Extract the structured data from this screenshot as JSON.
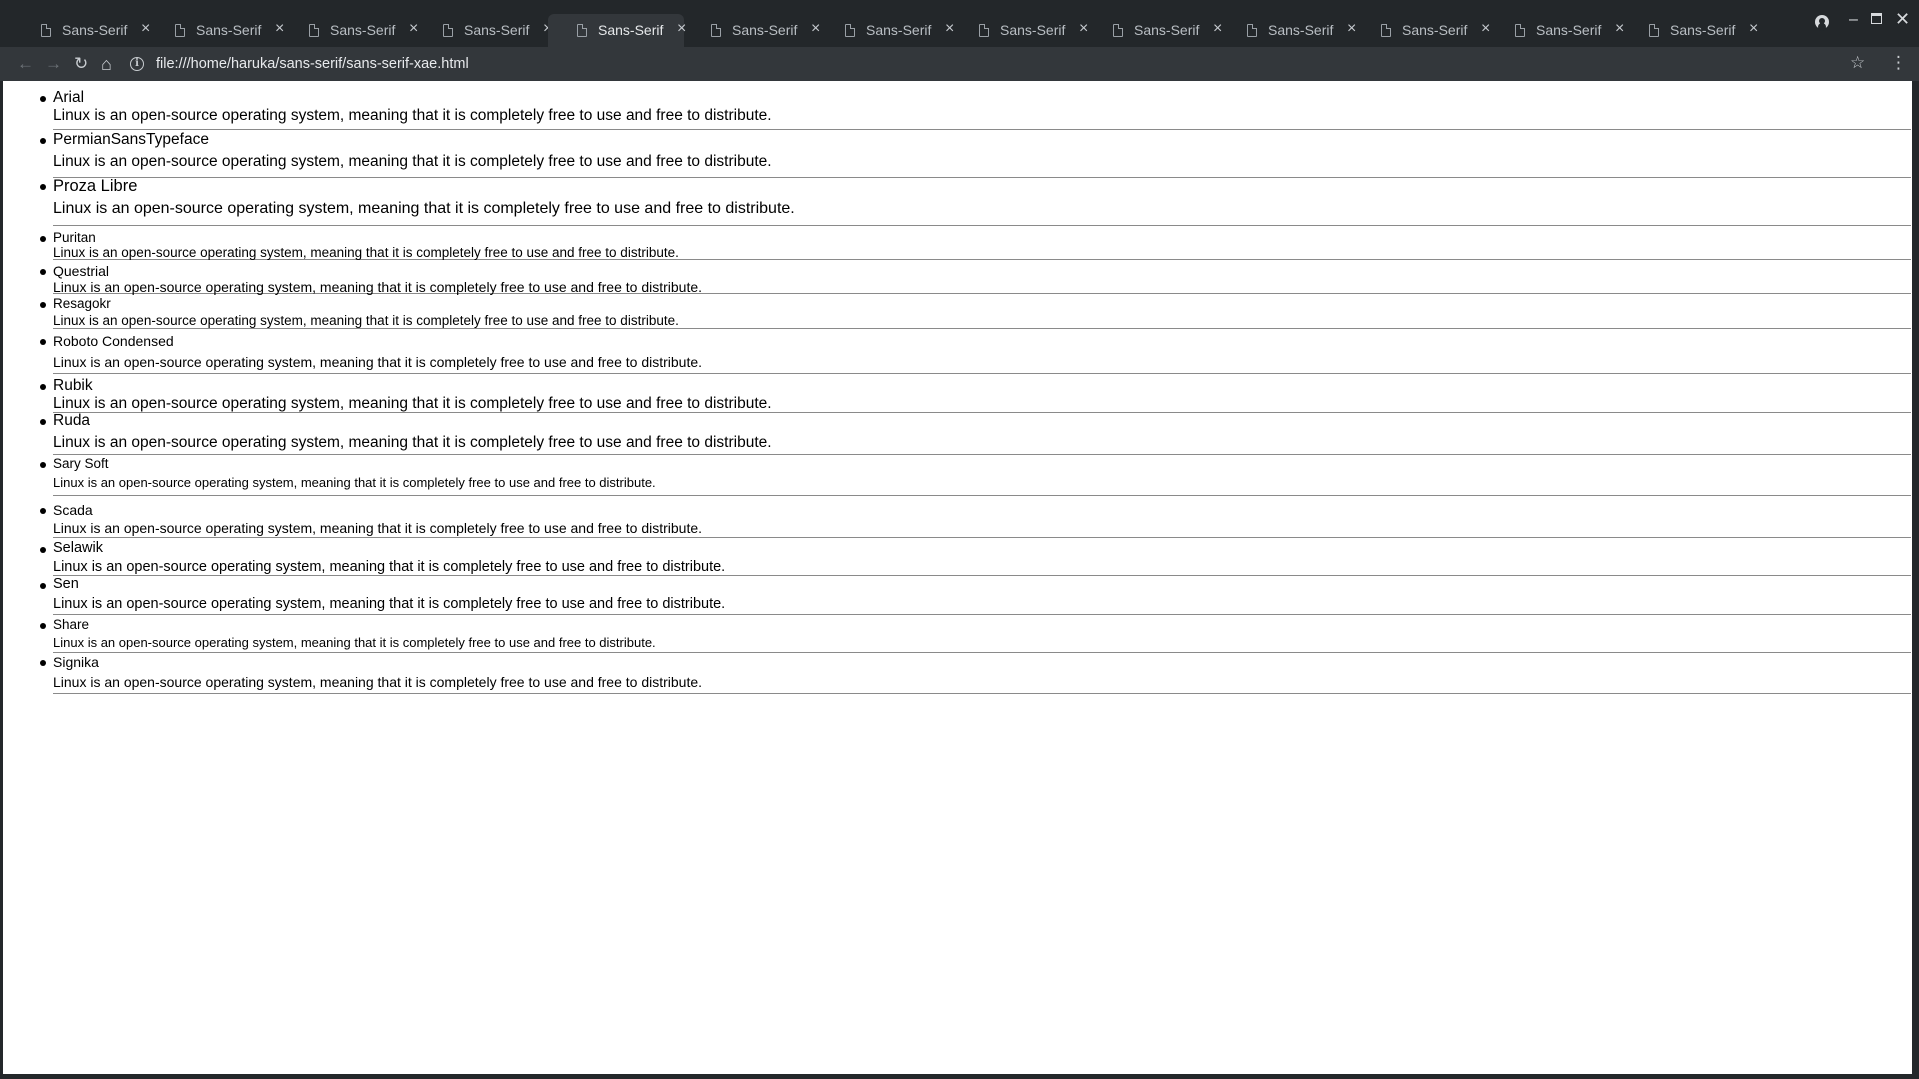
{
  "browser": {
    "tabs": [
      {
        "title": "Sans-Serif",
        "active": false
      },
      {
        "title": "Sans-Serif",
        "active": false
      },
      {
        "title": "Sans-Serif",
        "active": false
      },
      {
        "title": "Sans-Serif",
        "active": false
      },
      {
        "title": "Sans-Serif",
        "active": true
      },
      {
        "title": "Sans-Serif",
        "active": false
      },
      {
        "title": "Sans-Serif",
        "active": false
      },
      {
        "title": "Sans-Serif",
        "active": false
      },
      {
        "title": "Sans-Serif",
        "active": false
      },
      {
        "title": "Sans-Serif",
        "active": false
      },
      {
        "title": "Sans-Serif",
        "active": false
      },
      {
        "title": "Sans-Serif",
        "active": false
      },
      {
        "title": "Sans-Serif",
        "active": false
      }
    ],
    "url": "file:///home/haruka/sans-serif/sans-serif-xae.html"
  },
  "page": {
    "fonts": [
      {
        "name": "Arial",
        "sample": "Linux is an open-source operating system, meaning that it is completely free to use and free to distribute."
      },
      {
        "name": "PermianSansTypeface",
        "sample": "Linux is an open-source operating system, meaning that it is completely free to use and free to distribute."
      },
      {
        "name": "Proza Libre",
        "sample": "Linux is an open-source operating system, meaning that it is completely free to use and free to distribute."
      },
      {
        "name": "Puritan",
        "sample": "Linux is an open-source operating system, meaning that it is completely free to use and free to distribute."
      },
      {
        "name": "Questrial",
        "sample": "Linux is an open-source operating system, meaning that it is completely free to use and free to distribute."
      },
      {
        "name": "Resagokr",
        "sample": "Linux is an open-source operating system, meaning that it is completely free to use and free to distribute."
      },
      {
        "name": "Roboto Condensed",
        "sample": "Linux is an open-source operating system, meaning that it is completely free to use and free to distribute."
      },
      {
        "name": "Rubik",
        "sample": "Linux is an open-source operating system, meaning that it is completely free to use and free to distribute."
      },
      {
        "name": "Ruda",
        "sample": "Linux is an open-source operating system, meaning that it is completely free to use and free to distribute."
      },
      {
        "name": "Sary Soft",
        "sample": "Linux is an open-source operating system, meaning that it is completely free to use and free to distribute."
      },
      {
        "name": "Scada",
        "sample": "Linux is an open-source operating system, meaning that it is completely free to use and free to distribute."
      },
      {
        "name": "Selawik",
        "sample": "Linux is an open-source operating system, meaning that it is completely free to use and free to distribute."
      },
      {
        "name": "Sen",
        "sample": "Linux is an open-source operating system, meaning that it is completely free to use and free to distribute."
      },
      {
        "name": "Share",
        "sample": "Linux is an open-source operating system, meaning that it is completely free to use and free to distribute."
      },
      {
        "name": "Signika",
        "sample": "Linux is an open-source operating system, meaning that it is completely free to use and free to distribute."
      }
    ]
  }
}
